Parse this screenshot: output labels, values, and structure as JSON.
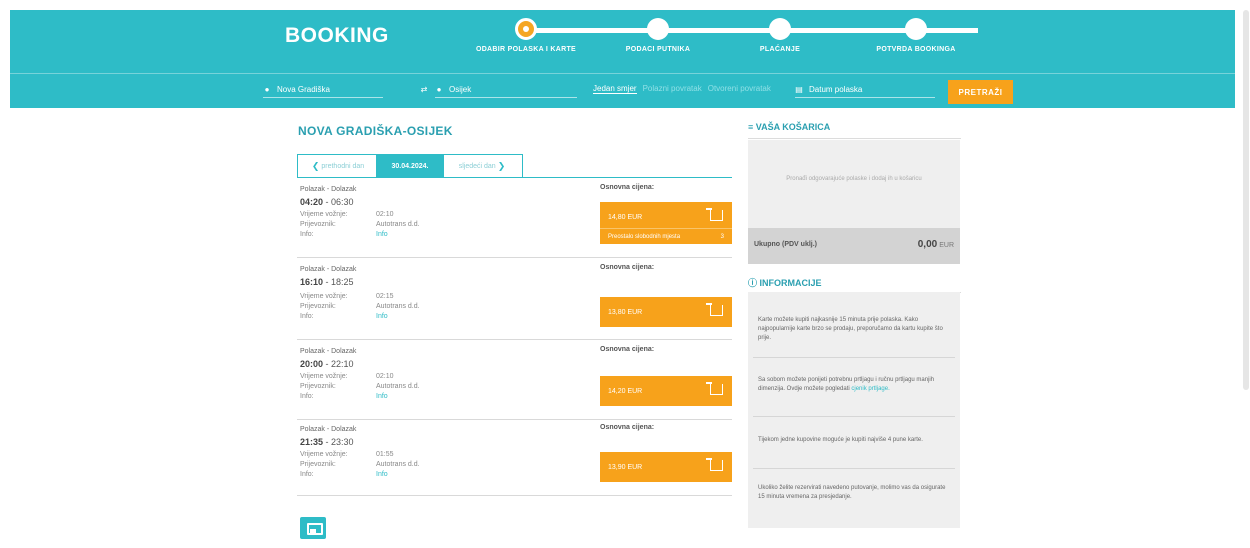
{
  "brand": "BOOKING",
  "steps": [
    {
      "label": "ODABIR POLASKA I KARTE",
      "active": true
    },
    {
      "label": "PODACI PUTNIKA",
      "active": false
    },
    {
      "label": "PLAĆANJE",
      "active": false
    },
    {
      "label": "POTVRDA BOOKINGA",
      "active": false
    }
  ],
  "search": {
    "from": "Nova Gradiška",
    "to": "Osijek",
    "swap_icon": "swap-arrows-icon",
    "trip_types": [
      "Jedan smjer",
      "Polazni povratak",
      "Otvoreni povratak"
    ],
    "date_placeholder": "Datum polaska",
    "button": "PRETRAŽI"
  },
  "main": {
    "route_title": "NOVA GRADIŠKA-OSIJEK",
    "prev_day": "prethodni dan",
    "current_day": "30.04.2024.",
    "next_day": "sljedeći dan",
    "trips": [
      {
        "sub": "Polazak - Dolazak",
        "dep": "04:20",
        "arr": "06:30",
        "duration_label": "Vrijeme vožnje:",
        "duration": "02:10",
        "carrier_label": "Prijevoznik:",
        "carrier": "Autotrans d.d.",
        "info_label": "Info:",
        "info": "Info",
        "price_label": "Osnovna cijena:",
        "price": "14,80 EUR",
        "seats": "Preostalo slobodnih mjesta",
        "seats_count": "3"
      },
      {
        "sub": "Polazak - Dolazak",
        "dep": "16:10",
        "arr": "18:25",
        "duration_label": "Vrijeme vožnje:",
        "duration": "02:15",
        "carrier_label": "Prijevoznik:",
        "carrier": "Autotrans d.d.",
        "info_label": "Info:",
        "info": "Info",
        "price_label": "Osnovna cijena:",
        "price": "13,80 EUR"
      },
      {
        "sub": "Polazak - Dolazak",
        "dep": "20:00",
        "arr": "22:10",
        "duration_label": "Vrijeme vožnje:",
        "duration": "02:10",
        "carrier_label": "Prijevoznik:",
        "carrier": "Autotrans d.d.",
        "info_label": "Info:",
        "info": "Info",
        "price_label": "Osnovna cijena:",
        "price": "14,20 EUR"
      },
      {
        "sub": "Polazak - Dolazak",
        "dep": "21:35",
        "arr": "23:30",
        "duration_label": "Vrijeme vožnje:",
        "duration": "01:55",
        "carrier_label": "Prijevoznik:",
        "carrier": "Autotrans d.d.",
        "info_label": "Info:",
        "info": "Info",
        "price_label": "Osnovna cijena:",
        "price": "13,90 EUR"
      }
    ]
  },
  "sidebar": {
    "cart_title": "VAŠA KOŠARICA",
    "cart_empty": "Pronađi odgovarajuće polaske i dodaj ih u košaricu",
    "total_label": "Ukupno (PDV uklj.)",
    "total_value": "0,00",
    "total_currency": "EUR",
    "info_title": "INFORMACIJE",
    "info_items": [
      "Karte možete kupiti najkasnije 15 minuta prije polaska. Kako najpopularnije karte brzo se prodaju, preporučamo da kartu kupite što prije.",
      "Sa sobom možete ponijeti potrebnu prtljagu i ručnu prtljagu manjih dimenzija. Ovdje možete pogledati",
      "Tijekom jedne kupovine moguće je kupiti najviše 4 pune karte.",
      "Ukoliko želite rezervirati navedeno putovanje, molimo vas da osigurate 15 minuta vremena za presjedanje."
    ],
    "info_link": "cjenik prtljage."
  }
}
